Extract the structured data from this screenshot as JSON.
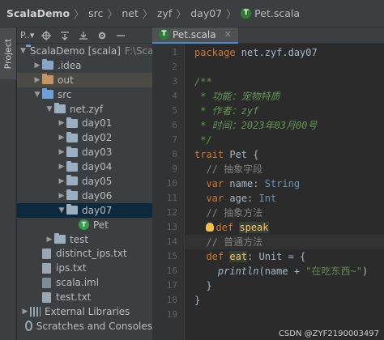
{
  "breadcrumb": {
    "items": [
      "ScalaDemo",
      "src",
      "net",
      "zyf",
      "day07",
      "Pet.scala"
    ],
    "file_icon_letter": "T"
  },
  "left_strip": {
    "tab_label": "Project"
  },
  "project_panel": {
    "view_selector": "P..▾",
    "tree": [
      {
        "label": "ScalaDemo [scala]",
        "detail": "F:\\Scal",
        "indent": 0,
        "arrow": "open",
        "icon": "folder-blue",
        "hl": false
      },
      {
        "label": ".idea",
        "detail": "",
        "indent": 1,
        "arrow": "closed",
        "icon": "folder",
        "hl": false
      },
      {
        "label": "out",
        "detail": "",
        "indent": 1,
        "arrow": "closed",
        "icon": "folder-orange",
        "hl": true
      },
      {
        "label": "src",
        "detail": "",
        "indent": 1,
        "arrow": "open",
        "icon": "folder-blue",
        "hl": false
      },
      {
        "label": "net.zyf",
        "detail": "",
        "indent": 2,
        "arrow": "open",
        "icon": "folder-pkg",
        "hl": false
      },
      {
        "label": "day01",
        "detail": "",
        "indent": 3,
        "arrow": "closed",
        "icon": "folder-pkg",
        "hl": false
      },
      {
        "label": "day02",
        "detail": "",
        "indent": 3,
        "arrow": "closed",
        "icon": "folder-pkg",
        "hl": false
      },
      {
        "label": "day03",
        "detail": "",
        "indent": 3,
        "arrow": "closed",
        "icon": "folder-pkg",
        "hl": false
      },
      {
        "label": "day04",
        "detail": "",
        "indent": 3,
        "arrow": "closed",
        "icon": "folder-pkg",
        "hl": false
      },
      {
        "label": "day05",
        "detail": "",
        "indent": 3,
        "arrow": "closed",
        "icon": "folder-pkg",
        "hl": false
      },
      {
        "label": "day06",
        "detail": "",
        "indent": 3,
        "arrow": "closed",
        "icon": "folder-pkg",
        "hl": false
      },
      {
        "label": "day07",
        "detail": "",
        "indent": 3,
        "arrow": "open",
        "icon": "folder-pkg",
        "hl": false,
        "sel": true
      },
      {
        "label": "Pet",
        "detail": "",
        "indent": 4,
        "arrow": "none",
        "icon": "scala-object",
        "hl": false
      },
      {
        "label": "test",
        "detail": "",
        "indent": 2,
        "arrow": "closed",
        "icon": "folder-pkg",
        "hl": false
      },
      {
        "label": "distinct_ips.txt",
        "detail": "",
        "indent": 1,
        "arrow": "none",
        "icon": "file",
        "hl": false
      },
      {
        "label": "ips.txt",
        "detail": "",
        "indent": 1,
        "arrow": "none",
        "icon": "file",
        "hl": false
      },
      {
        "label": "scala.iml",
        "detail": "",
        "indent": 1,
        "arrow": "none",
        "icon": "file-iml",
        "hl": false
      },
      {
        "label": "test.txt",
        "detail": "",
        "indent": 1,
        "arrow": "none",
        "icon": "file",
        "hl": false
      },
      {
        "label": "External Libraries",
        "detail": "",
        "indent": 0,
        "arrow": "closed",
        "icon": "library",
        "hl": false
      },
      {
        "label": "Scratches and Consoles",
        "detail": "",
        "indent": 0,
        "arrow": "none",
        "icon": "scratches",
        "hl": false
      }
    ]
  },
  "editor": {
    "tab_label": "Pet.scala",
    "tab_icon_letter": "T",
    "current_line": 14,
    "line_numbers": [
      "1",
      "2",
      "3",
      "4",
      "5",
      "6",
      "7",
      "8",
      "9",
      "10",
      "11",
      "12",
      "13",
      "14",
      "15",
      "16",
      "17",
      "18",
      "19"
    ],
    "lines": [
      [
        {
          "t": "package",
          "c": "kw"
        },
        {
          "t": " net.zyf.day07",
          "c": "pl"
        }
      ],
      [],
      [
        {
          "t": "/**",
          "c": "doc"
        }
      ],
      [
        {
          "t": " * 功能：宠物特质",
          "c": "doc"
        }
      ],
      [
        {
          "t": " * 作者：zyf",
          "c": "doc"
        }
      ],
      [
        {
          "t": " * 时间：2023年03月00号",
          "c": "doc"
        }
      ],
      [
        {
          "t": " */",
          "c": "doc"
        }
      ],
      [
        {
          "t": "trait",
          "c": "kw"
        },
        {
          "t": " Pet {",
          "c": "pl"
        }
      ],
      [
        {
          "t": "  // 抽象字段",
          "c": "cmt"
        }
      ],
      [
        {
          "t": "  ",
          "c": "pl"
        },
        {
          "t": "var",
          "c": "kw"
        },
        {
          "t": " name: ",
          "c": "pl"
        },
        {
          "t": "String",
          "c": "tname"
        }
      ],
      [
        {
          "t": "  ",
          "c": "pl"
        },
        {
          "t": "var",
          "c": "kw"
        },
        {
          "t": " age: ",
          "c": "pl"
        },
        {
          "t": "Int",
          "c": "tname"
        }
      ],
      [
        {
          "t": "  // 抽象方法",
          "c": "cmt"
        }
      ],
      [
        {
          "t": "  ",
          "c": "pl"
        },
        {
          "t": "BULB",
          "c": "bulb"
        },
        {
          "t": "def",
          "c": "kw"
        },
        {
          "t": " ",
          "c": "pl"
        },
        {
          "t": "speak",
          "c": "fnd"
        }
      ],
      [
        {
          "t": "  // 普通方法",
          "c": "cmt"
        }
      ],
      [
        {
          "t": "  ",
          "c": "pl"
        },
        {
          "t": "def",
          "c": "kw"
        },
        {
          "t": " ",
          "c": "pl"
        },
        {
          "t": "eat",
          "c": "fnd"
        },
        {
          "t": ": Unit = {",
          "c": "pl"
        }
      ],
      [
        {
          "t": "    ",
          "c": "pl"
        },
        {
          "t": "println",
          "c": "ital"
        },
        {
          "t": "(name + ",
          "c": "pl"
        },
        {
          "t": "\"在吃东西~\"",
          "c": "str"
        },
        {
          "t": ")",
          "c": "pl"
        }
      ],
      [
        {
          "t": "  }",
          "c": "pl"
        }
      ],
      [
        {
          "t": "}",
          "c": "pl"
        }
      ],
      []
    ]
  },
  "watermark": "CSDN @ZYF2190003497",
  "colors": {
    "background": "#2b2b2b",
    "panel": "#3c3f41",
    "keyword": "#cc7832",
    "doc_comment": "#629755",
    "string": "#6a8759",
    "function": "#ffc66d",
    "type": "#6897bb",
    "selection": "#0d293e"
  }
}
